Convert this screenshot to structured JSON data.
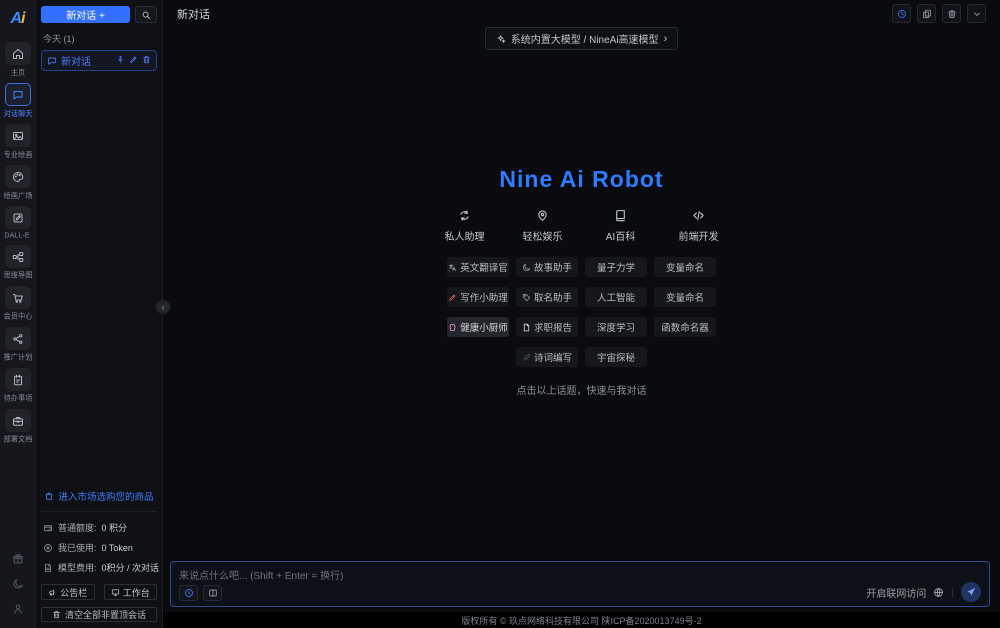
{
  "colors": {
    "accent": "#3370ff",
    "hero_title": "#2e7bff",
    "chip_bg": "#16171b",
    "page_bg": "#0a0b0e"
  },
  "rail": {
    "logo_a": "A",
    "logo_i": "i",
    "items": [
      {
        "label": "主页",
        "icon": "home-icon",
        "active": false
      },
      {
        "label": "对话聊天",
        "icon": "chat-icon",
        "active": true
      },
      {
        "label": "专业绘画",
        "icon": "image-icon",
        "active": false
      },
      {
        "label": "绘画广场",
        "icon": "palette-icon",
        "active": false
      },
      {
        "label": "DALL-E",
        "icon": "pen-square-icon",
        "active": false
      },
      {
        "label": "思维导图",
        "icon": "mindmap-icon",
        "active": false
      },
      {
        "label": "会员中心",
        "icon": "cart-icon",
        "active": false
      },
      {
        "label": "推广计划",
        "icon": "share-icon",
        "active": false
      },
      {
        "label": "待办事项",
        "icon": "todo-icon",
        "active": false
      },
      {
        "label": "部署文档",
        "icon": "briefcase-icon",
        "active": false
      }
    ],
    "bottom_icons": [
      "gift-icon",
      "moon-icon",
      "user-icon"
    ]
  },
  "sidebar": {
    "new_chat_label": "新对话 +",
    "search_icon": "search-icon",
    "group_label": "今天 (1)",
    "chat_item": {
      "icon": "chat-icon",
      "label": "新对话",
      "actions": [
        "pushpin-icon",
        "pencil-icon",
        "trash-icon"
      ]
    },
    "market_link": {
      "icon": "bag-icon",
      "label": "进入市场选购您的商品"
    },
    "stats": [
      {
        "icon": "wallet-icon",
        "label": "普通额度:",
        "value": "0 积分"
      },
      {
        "icon": "coin-icon",
        "label": "我已使用:",
        "value": "0 Token"
      },
      {
        "icon": "file-icon",
        "label": "模型费用:",
        "value": "0积分 / 次对话"
      }
    ],
    "tool_buttons": [
      {
        "icon": "megaphone-icon",
        "label": "公告栏"
      },
      {
        "icon": "monitor-icon",
        "label": "工作台"
      }
    ],
    "clear_button": {
      "icon": "trash-icon",
      "label": "清空全部非置顶会话"
    }
  },
  "header": {
    "title": "新对话",
    "actions": [
      {
        "icon": "history-icon",
        "accent": true
      },
      {
        "icon": "copy-icon",
        "accent": false
      },
      {
        "icon": "trash-icon",
        "accent": false
      },
      {
        "icon": "chevron-down-icon",
        "accent": false
      }
    ]
  },
  "banner": {
    "icon": "model-icon",
    "label": "系统内置大模型 / NineAi高速模型",
    "chevron": "›"
  },
  "hero": {
    "title": "Nine Ai Robot",
    "categories": [
      {
        "icon": "assistant-icon",
        "label": "私人助理"
      },
      {
        "icon": "location-icon",
        "label": "轻松娱乐"
      },
      {
        "icon": "book-icon",
        "label": "AI百科"
      },
      {
        "icon": "code-icon",
        "label": "前端开发"
      }
    ],
    "suggestions": [
      [
        {
          "label": "英文翻译官",
          "icon": "translate-icon",
          "icon_color": "#9aa0a8"
        },
        {
          "label": "故事助手",
          "icon": "moon-icon",
          "icon_color": "#9aa0a8"
        },
        {
          "label": "量子力学"
        },
        {
          "label": "变量命名"
        }
      ],
      [
        {
          "label": "写作小助理",
          "icon": "pencil-icon",
          "icon_color": "#e05b4d"
        },
        {
          "label": "取名助手",
          "icon": "tag-icon",
          "icon_color": "#9aa0a8"
        },
        {
          "label": "人工智能"
        },
        {
          "label": "变量命名"
        }
      ],
      [
        {
          "label": "健康小厨师",
          "icon": "chef-icon",
          "icon_color": "#e89bd0",
          "highlight": true
        },
        {
          "label": "求职报告",
          "icon": "doc-icon",
          "icon_color": "#e6e8ec"
        },
        {
          "label": "深度学习"
        },
        {
          "label": "函数命名器"
        }
      ],
      [
        null,
        {
          "label": "诗词编写",
          "icon": "feather-icon",
          "icon_color": "#565b63"
        },
        {
          "label": "宇宙探秘"
        },
        null
      ]
    ],
    "hint": "点击以上话题，快速与我对话"
  },
  "composer": {
    "placeholder": "来说点什么吧... (Shift + Enter = 换行)",
    "buttons": [
      {
        "icon": "history-icon",
        "accent": true
      },
      {
        "icon": "columns-icon",
        "accent": false
      }
    ],
    "network_label": "开启联网访问",
    "network_icon": "globe-icon",
    "divider": "|",
    "send_icon": "send-icon"
  },
  "footer": {
    "copyright": "版权所有 © 玖点网络科技有限公司 陕ICP备2020013749号-2"
  },
  "collapse_glyph": "‹"
}
